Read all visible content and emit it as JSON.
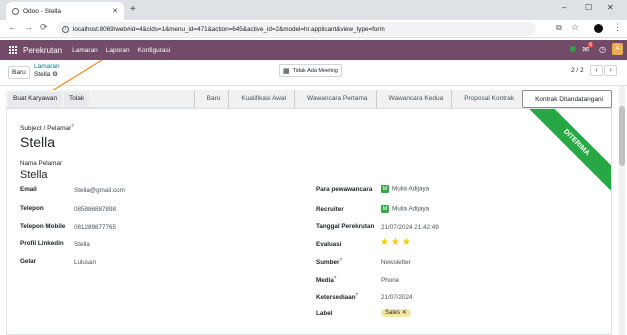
{
  "browser": {
    "tab_title": "Odoo - Stella",
    "tab_close": "✕",
    "new_tab": "+",
    "url": "localhost:8069/web#id=4&cids=1&menu_id=471&action=645&active_id=2&model=hr.applicant&view_type=form",
    "win_min": "–",
    "win_max": "☐",
    "win_close": "✕"
  },
  "navbar": {
    "brand": "Perekrutan",
    "menu": [
      "Lamaran",
      "Laporan",
      "Konfigurasi"
    ],
    "msg_count": "6",
    "avatar_letter": "A"
  },
  "control": {
    "new_button": "Baru",
    "breadcrumb_parent": "Lamaran",
    "breadcrumb_current": "Stella",
    "meeting_button": "Tidak Ada Meeting",
    "pager": "2 / 2"
  },
  "actions": {
    "create_employee": "Buat Karyawan",
    "refuse": "Tolak"
  },
  "stages": [
    "Baru",
    "Kualifikasi Awal",
    "Wawancara Pertama",
    "Wawancara Kedua",
    "Proposal Kontrak",
    "Kontrak Ditandatangani"
  ],
  "active_stage": "Kontrak Ditandatangani",
  "ribbon": "DITERIMA",
  "form": {
    "subject_label": "Subject / Pelamar",
    "subject_value": "Stella",
    "name_label": "Nama Pelamar",
    "name_value": "Stella",
    "tooltip_mark": "?",
    "left_fields": [
      {
        "label": "Email",
        "value": "Stella@gmail.com"
      },
      {
        "label": "Telepon",
        "value": "085886887898"
      },
      {
        "label": "Telepon Mobile",
        "value": "081289877765"
      },
      {
        "label": "Profil Linkedin",
        "value": "Stella"
      },
      {
        "label": "Gelar",
        "value": "Lulusan"
      }
    ],
    "interviewer_label": "Para pewawancara",
    "interviewer_initial": "M",
    "interviewer_value": "Mulia Adijaya",
    "recruiter_label": "Recruiter",
    "recruiter_initial": "M",
    "recruiter_value": "Mulia Adijaya",
    "created_label": "Tanggal Perekrutan",
    "created_value": "21/07/2024 21:42:49",
    "evaluation_label": "Evaluasi",
    "evaluation_stars": 3,
    "source_label": "Sumber",
    "source_value": "Newsletter",
    "medium_label": "Media",
    "medium_value": "Phone",
    "availability_label": "Ketersediaan",
    "availability_value": "21/07/2024",
    "tags_label": "Label",
    "tag_value": "Sales",
    "tag_remove": "✕"
  },
  "colors": {
    "navbar": "#714b67",
    "ribbon": "#28a745",
    "annotation_arrow": "#f08a24"
  }
}
